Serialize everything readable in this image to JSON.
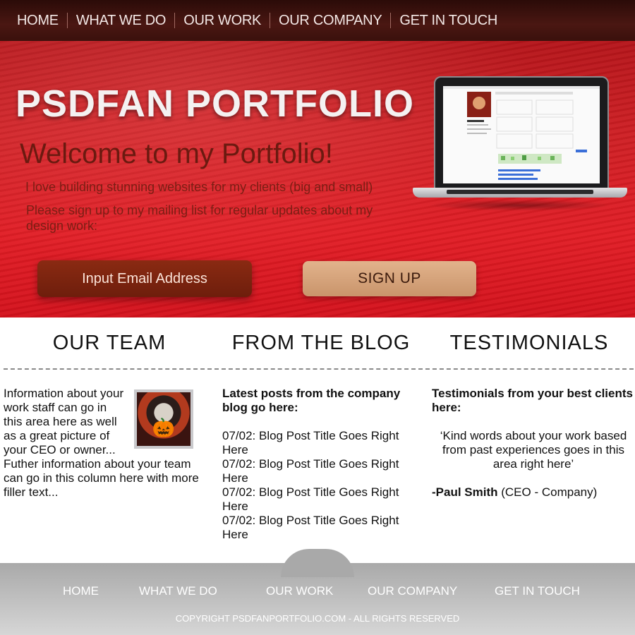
{
  "nav": {
    "items": [
      "HOME",
      "WHAT WE DO",
      "OUR WORK",
      "OUR COMPANY",
      "GET IN TOUCH"
    ]
  },
  "hero": {
    "title": "PSDFAN PORTFOLIO",
    "welcome": "Welcome to my Portfolio!",
    "line1": "I love building stunning websites for my clients (big and small)",
    "line2": "Please sign up to my mailing list for regular updates about my design work:",
    "email_placeholder": "Input Email Address",
    "signup_label": "SIGN UP"
  },
  "sections": {
    "team": {
      "heading": "OUR TEAM",
      "text": "Information about your work staff can go in  this area here as well as a great picture of  your CEO or owner... Futher information about your team can go in this column here with more filler text..."
    },
    "blog": {
      "heading": "FROM THE BLOG",
      "lead": "Latest posts from the company blog go here:",
      "posts": [
        "07/02: Blog Post Title Goes Right Here",
        "07/02: Blog Post Title Goes Right Here",
        "07/02: Blog Post Title Goes Right Here",
        "07/02: Blog Post Title Goes Right Here"
      ]
    },
    "testimonials": {
      "heading": "TESTIMONIALS",
      "lead": "Testimonials from your best clients here:",
      "quote": "‘Kind words about your work based from past experiences goes in this area right here’",
      "author": "-Paul Smith",
      "author_role": " (CEO - Company)"
    }
  },
  "footer": {
    "links": [
      "HOME",
      "WHAT WE DO",
      "OUR WORK",
      "OUR COMPANY",
      "GET IN TOUCH"
    ],
    "copyright": "COPYRIGHT PSDFANPORTFOLIO.COM - ALL RIGHTS RESERVED"
  }
}
